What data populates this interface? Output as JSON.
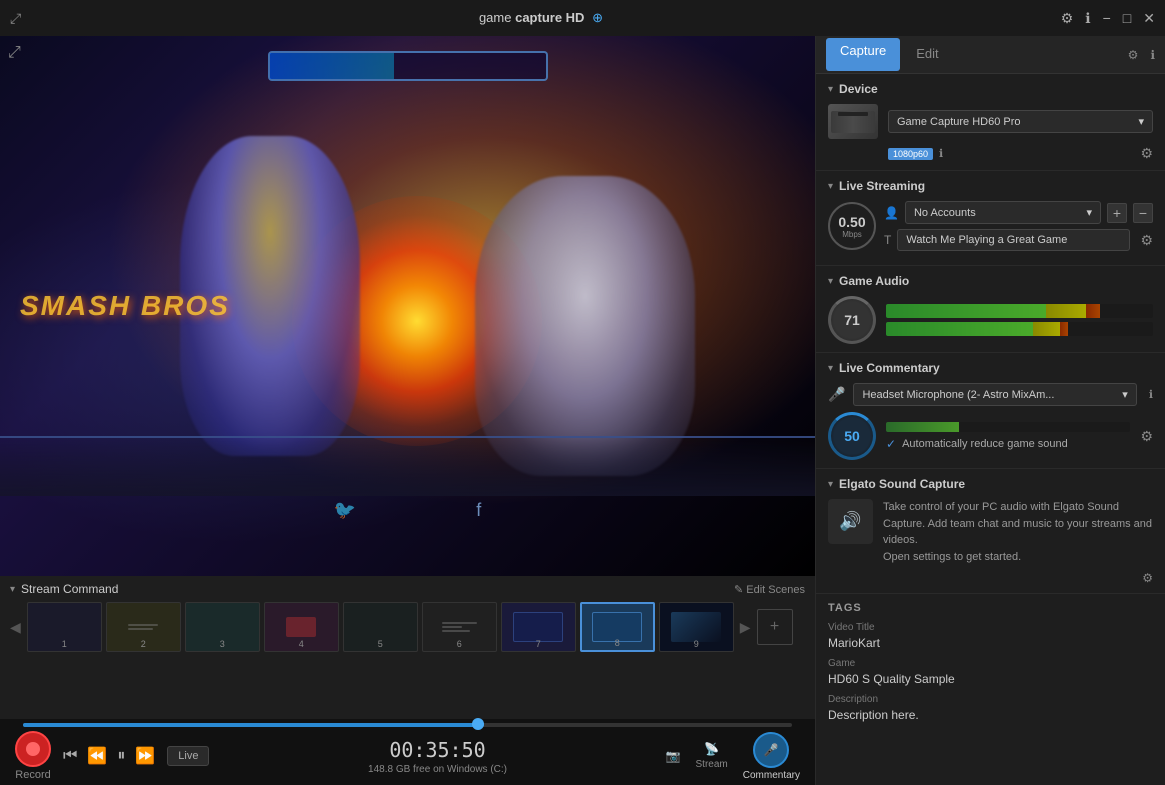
{
  "titleBar": {
    "title_plain": "game",
    "title_bold": "capture HD",
    "title_icon": "⊕"
  },
  "tabs": {
    "capture": "Capture",
    "edit": "Edit"
  },
  "rightPanel": {
    "settings_icon": "⚙",
    "info_icon": "ℹ",
    "device": {
      "title": "Device",
      "name": "Game Capture HD60 Pro",
      "badge": "1080p60",
      "info_label": "i"
    },
    "liveStreaming": {
      "title": "Live Streaming",
      "mbps": "0.50",
      "mbps_unit": "Mbps",
      "account_placeholder": "No Accounts",
      "title_placeholder": "Watch Me Playing a Great Game",
      "title_icon": "T"
    },
    "gameAudio": {
      "title": "Game Audio",
      "volume": "71",
      "meter1_green": 60,
      "meter1_yellow": 15,
      "meter1_red": 5,
      "meter2_green": 55,
      "meter2_yellow": 10,
      "meter2_red": 3
    },
    "liveCommentary": {
      "title": "Live Commentary",
      "mic_name": "Headset Microphone (2- Astro MixAm...",
      "volume": "50",
      "auto_reduce_label": "Automatically reduce game sound"
    },
    "elgatoSoundCapture": {
      "title": "Elgato Sound Capture",
      "description": "Take control of your PC audio with Elgato Sound Capture. Add team chat and music to your streams and videos.",
      "action": "Open settings to get started."
    },
    "tags": {
      "section_title": "Tags",
      "video_title_label": "Video Title",
      "video_title_value": "MarioKart",
      "game_label": "Game",
      "game_value": "HD60 S Quality Sample",
      "description_label": "Description",
      "description_value": "Description here."
    }
  },
  "streamCommand": {
    "title": "Stream Command",
    "edit_scenes": "✎ Edit Scenes",
    "scenes": [
      {
        "number": "1",
        "class": "thumb-1"
      },
      {
        "number": "2",
        "class": "thumb-2"
      },
      {
        "number": "3",
        "class": "thumb-3"
      },
      {
        "number": "4",
        "class": "thumb-4"
      },
      {
        "number": "5",
        "class": "thumb-5"
      },
      {
        "number": "6",
        "class": "thumb-6"
      },
      {
        "number": "7",
        "class": "thumb-7"
      },
      {
        "number": "8",
        "class": "thumb-8",
        "active": true
      },
      {
        "number": "9",
        "class": "thumb-9"
      }
    ]
  },
  "transport": {
    "record_label": "Record",
    "timer": "00:35:50",
    "disk_info": "148.8 GB free on Windows (C:)",
    "stream_label": "Stream",
    "commentary_label": "Commentary",
    "live_btn": "Live"
  },
  "icons": {
    "expand": "⤢",
    "settings": "⚙",
    "info": "ℹ",
    "chevron_down": "▾",
    "add": "+",
    "minus": "−",
    "mic": "🎤",
    "speaker": "🔊",
    "camera": "📷",
    "rewind": "⏮",
    "back": "⏪",
    "pause": "⏸",
    "forward": "⏩",
    "arrow_left": "◀",
    "arrow_right": "▶"
  }
}
